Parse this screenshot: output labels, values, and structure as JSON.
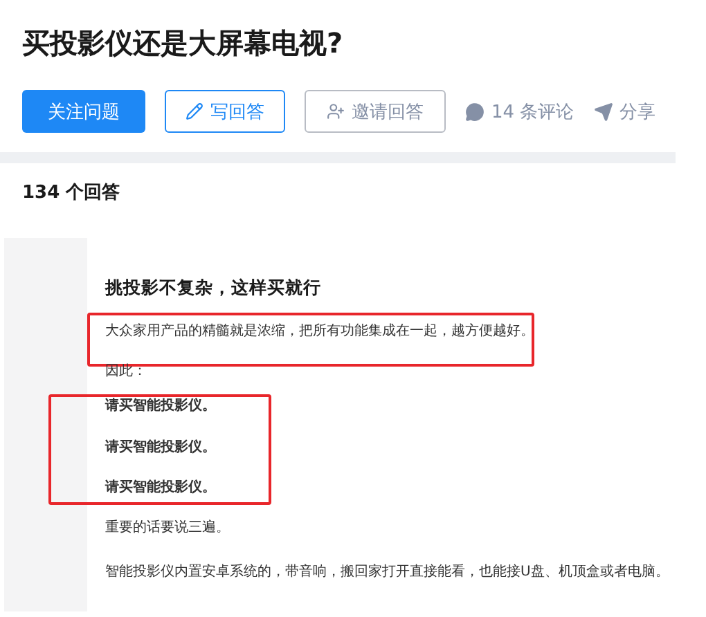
{
  "question": {
    "title": "买投影仪还是大屏幕电视?"
  },
  "actions": [
    {
      "kind": "primary",
      "label": "关注问题"
    },
    {
      "kind": "outline",
      "label": "写回答"
    },
    {
      "kind": "ghost",
      "label": "邀请回答"
    }
  ],
  "meta": [
    {
      "kind": "comment",
      "label": "14 条评论"
    },
    {
      "kind": "share",
      "label": "分享"
    }
  ],
  "answer_count": "134 个回答",
  "answer": {
    "heading": "挑投影不复杂，这样买就行",
    "blocks": [
      {
        "kind": "box",
        "color": "#e8262b",
        "paragraphs": [
          {
            "text": "大众家用产品的精髓就是浓缩，把所有功能集成在一起，越方便越好。",
            "bold": false
          }
        ]
      },
      {
        "kind": "plain",
        "paragraphs": [
          {
            "text": "因此：",
            "bold": false
          }
        ]
      },
      {
        "kind": "widebox",
        "color": "#e8262b",
        "paragraphs": [
          {
            "text": "请买智能投影仪。",
            "bold": true
          },
          {
            "text": "请买智能投影仪。",
            "bold": true
          },
          {
            "text": "请买智能投影仪。",
            "bold": true
          }
        ]
      },
      {
        "kind": "plain",
        "paragraphs": [
          {
            "text": "重要的话要说三遍。",
            "bold": false
          },
          {
            "text": "智能投影仪内置安卓系统的，带音响，搬回家打开直接能看，也能接U盘、机顶盒或者电脑。",
            "bold": false
          }
        ]
      }
    ]
  }
}
